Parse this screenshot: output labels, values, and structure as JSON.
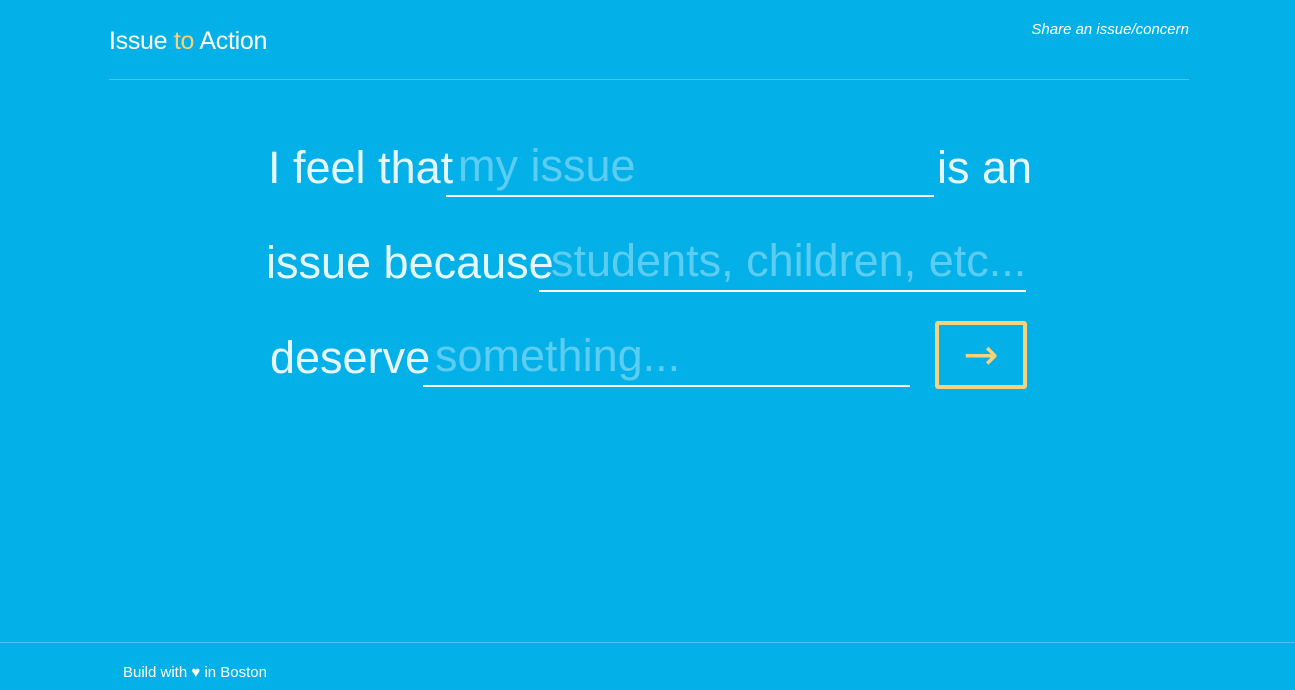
{
  "header": {
    "logo": {
      "part1": "Issue ",
      "accent": "to",
      "part2": " Action"
    },
    "share_link": "Share an issue/concern"
  },
  "form": {
    "line1_prefix": "I feel that",
    "issue_placeholder": "my issue",
    "line1_suffix": "is an",
    "line2_prefix": "issue because",
    "group_placeholder": "students, children, etc...",
    "line3_prefix": "deserve",
    "need_placeholder": "something...",
    "submit_icon": "→"
  },
  "footer": {
    "text": "Build with ♥ in Boston"
  },
  "colors": {
    "background": "#04b0e8",
    "accent": "#f6d27c",
    "placeholder": "#5bcdf2"
  }
}
